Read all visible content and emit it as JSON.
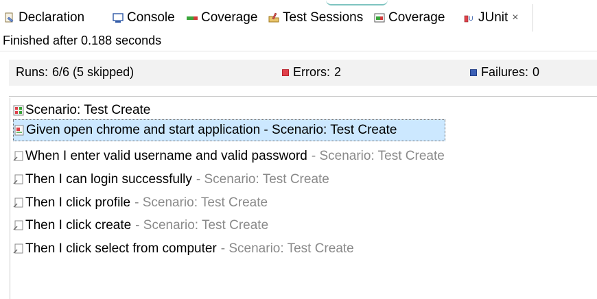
{
  "tabs": [
    {
      "label": "Declaration",
      "icon": "declaration-icon"
    },
    {
      "label": "Console",
      "icon": "console-icon"
    },
    {
      "label": "Coverage",
      "icon": "coverage-bar-icon"
    },
    {
      "label": "Test Sessions",
      "icon": "test-sessions-icon"
    },
    {
      "label": "Coverage",
      "icon": "coverage-report-icon"
    },
    {
      "label": "JUnit",
      "icon": "junit-icon",
      "active": true,
      "close": "×"
    }
  ],
  "status": "Finished after 0.188 seconds",
  "counters": {
    "runs_label": "Runs:",
    "runs_value": "6/6 (5 skipped)",
    "errors_label": "Errors:",
    "errors_value": "2",
    "failures_label": "Failures:",
    "failures_value": "0"
  },
  "tree": [
    {
      "text": "Scenario: Test Create",
      "suffix": "",
      "icon": "suite-error-icon"
    },
    {
      "text": "Given open chrome and start application - Scenario: Test Create",
      "suffix": "",
      "icon": "test-error-icon",
      "selected": true
    },
    {
      "text": "When I enter valid username and valid password",
      "suffix": "- Scenario: Test Create",
      "icon": "test-skipped-icon"
    },
    {
      "text": "Then I can login successfully",
      "suffix": "- Scenario: Test Create",
      "icon": "test-skipped-icon"
    },
    {
      "text": "Then I click profile",
      "suffix": "- Scenario: Test Create",
      "icon": "test-skipped-icon"
    },
    {
      "text": "Then I click create",
      "suffix": "- Scenario: Test Create",
      "icon": "test-skipped-icon"
    },
    {
      "text": "Then I click select from computer",
      "suffix": "- Scenario: Test Create",
      "icon": "test-skipped-icon"
    }
  ],
  "colors": {
    "selection": "#cce8ff",
    "error": "#e0414b",
    "failure": "#3b5fb5",
    "suffix_gray": "#8a8a8a"
  }
}
